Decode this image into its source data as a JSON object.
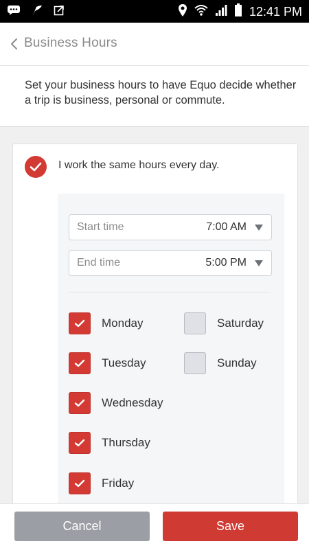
{
  "status_bar": {
    "time": "12:41 PM",
    "icons": [
      "chat-bubble-icon",
      "feather-icon",
      "external-link-icon",
      "location-pin-icon",
      "wifi-icon",
      "signal-icon",
      "battery-icon"
    ]
  },
  "header": {
    "back_icon": "chevron-left-icon",
    "title": "Business Hours"
  },
  "description": "Set your business hours to have Equo decide whether a trip is business, personal or commute.",
  "same_hours": {
    "label": "I work the same hours every day.",
    "checked": true
  },
  "start_time": {
    "label": "Start time",
    "value": "7:00 AM"
  },
  "end_time": {
    "label": "End time",
    "value": "5:00 PM"
  },
  "days": [
    {
      "label": "Monday",
      "checked": true
    },
    {
      "label": "Tuesday",
      "checked": true
    },
    {
      "label": "Wednesday",
      "checked": true
    },
    {
      "label": "Thursday",
      "checked": true
    },
    {
      "label": "Friday",
      "checked": true
    },
    {
      "label": "Saturday",
      "checked": false
    },
    {
      "label": "Sunday",
      "checked": false
    }
  ],
  "buttons": {
    "cancel": "Cancel",
    "save": "Save"
  },
  "colors": {
    "accent": "#d23a33",
    "cancel_gray": "#9b9ea4",
    "text": "#333333",
    "muted": "#8a8a8a"
  }
}
